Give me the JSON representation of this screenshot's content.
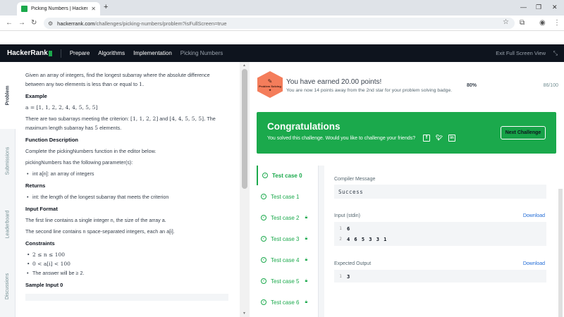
{
  "browser": {
    "tab_title": "Picking Numbers | HackerRank",
    "url_host": "hackerrank.com",
    "url_path": "/challenges/picking-numbers/problem?isFullScreen=true"
  },
  "navbar": {
    "logo": "HackerRank",
    "links": [
      "Prepare",
      "Algorithms",
      "Implementation",
      "Picking Numbers"
    ],
    "exit_label": "Exit Full Screen View"
  },
  "side_tabs": [
    "Problem",
    "Submissions",
    "Leaderboard",
    "Discussions"
  ],
  "problem": {
    "intro": "Given an array of integers, find the longest subarray where the absolute difference between any two elements is less than or equal to",
    "intro_num": "1.",
    "example_heading": "Example",
    "example_array": "a = [1, 1, 2, 2, 4, 4, 5, 5, 5]",
    "example_text_1": "There are two subarrays meeting the criterion:",
    "example_sub1": "[1, 1, 2, 2]",
    "example_and": "and",
    "example_sub2": "[4, 4, 5, 5, 5].",
    "example_text_2": "The maximum length subarray has",
    "example_len": "5",
    "example_text_3": "elements.",
    "func_heading": "Function Description",
    "func_text": "Complete the pickingNumbers function in the editor below.",
    "params_text": "pickingNumbers has the following parameter(s):",
    "param_1": "int a[n]: an array of integers",
    "returns_heading": "Returns",
    "returns_1": "int: the length of the longest subarray that meets the criterion",
    "input_heading": "Input Format",
    "input_1": "The first line contains a single integer n, the size of the array a.",
    "input_2": "The second line contains n space-separated integers, each an a[i].",
    "constraints_heading": "Constraints",
    "constraint_1": "2 ≤ n ≤ 100",
    "constraint_2": "0 < a[i] < 100",
    "constraint_3": "The answer will be ≥ 2.",
    "sample_heading": "Sample Input 0"
  },
  "badge": {
    "label": "Problem Solving",
    "earned": "You have earned 20.00 points!",
    "sub": "You are now 14 points away from the 2nd star for your problem solving badge.",
    "percent": "80%",
    "score": "86/100"
  },
  "congrats": {
    "title": "Congratulations",
    "subtitle": "You solved this challenge. Would you like to challenge your friends?",
    "next_button": "Next Challenge"
  },
  "test_cases": [
    {
      "label": "Test case 0",
      "locked": false
    },
    {
      "label": "Test case 1",
      "locked": false
    },
    {
      "label": "Test case 2",
      "locked": true
    },
    {
      "label": "Test case 3",
      "locked": true
    },
    {
      "label": "Test case 4",
      "locked": true
    },
    {
      "label": "Test case 5",
      "locked": true
    },
    {
      "label": "Test case 6",
      "locked": true
    }
  ],
  "result": {
    "compiler_label": "Compiler Message",
    "compiler_value": "Success",
    "input_label": "Input (stdin)",
    "download": "Download",
    "input_lines": [
      {
        "n": "1",
        "text": "6"
      },
      {
        "n": "2",
        "text": "4 6 5 3 3 1"
      }
    ],
    "expected_label": "Expected Output",
    "expected_lines": [
      {
        "n": "1",
        "text": "3"
      }
    ]
  },
  "colors": {
    "brand_green": "#1ba94c",
    "nav_dark": "#0e141e",
    "badge_orange": "#f47d5b",
    "link_blue": "#1f6ad6"
  }
}
